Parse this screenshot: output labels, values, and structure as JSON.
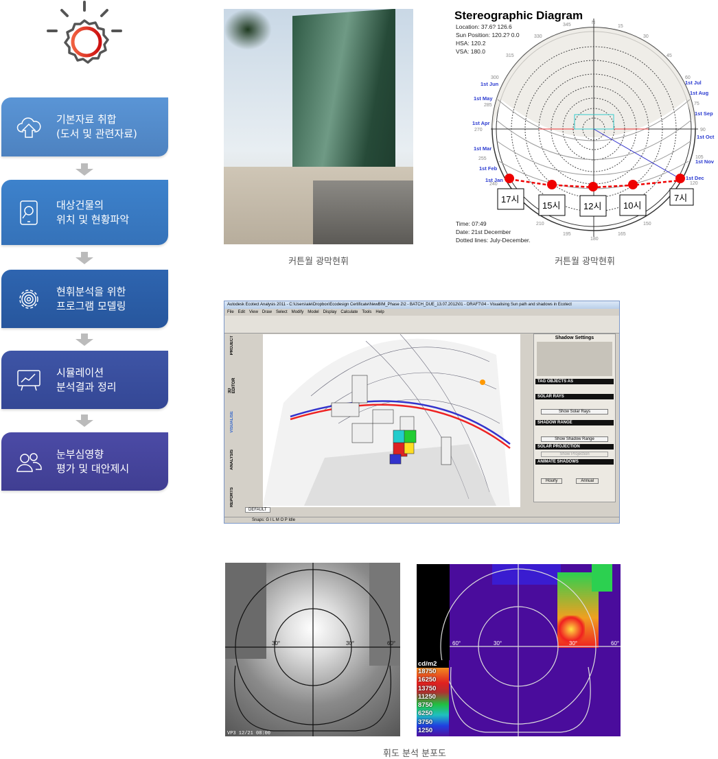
{
  "steps": [
    {
      "icon": "cloud-upload-icon",
      "label": "기본자료 취합\n(도서 및 관련자료)",
      "color": "#5690d2"
    },
    {
      "icon": "tablet-search-icon",
      "label": "대상건물의\n위치 및 현황파악",
      "color": "#3b7bc6"
    },
    {
      "icon": "gear-icon",
      "label": "현휘분석을 위한\n프로그램 모델링",
      "color": "#2c5ea9"
    },
    {
      "icon": "presentation-chart-icon",
      "label": "시뮬레이션\n분석결과 정리",
      "color": "#3a4d9f"
    },
    {
      "icon": "users-icon",
      "label": "눈부심영향\n평가 및 대안제시",
      "color": "#48479e"
    }
  ],
  "captions": {
    "photo": "커튼월 광막현휘",
    "diagram": "커튼월 광막현휘",
    "luminance": "휘도 분석 분포도"
  },
  "diagram": {
    "title": "Stereographic Diagram",
    "info": [
      "Location: 37.6? 126.6",
      "Sun Position: 120.2? 0.0",
      "HSA: 120.2",
      "VSA: 180.0"
    ],
    "footer": [
      "Time: 07:49",
      "Date: 21st December",
      "Dotted lines: July-December."
    ],
    "north": "N",
    "months_left": [
      "1st Jun",
      "1st May",
      "1st Apr",
      "1st Mar",
      "1st Feb",
      "1st Jan"
    ],
    "months_right": [
      "1st Jul",
      "1st Aug",
      "1st Sep",
      "1st Oct",
      "1st Nov",
      "1st Dec"
    ],
    "hour_boxes": [
      "17시",
      "15시",
      "12시",
      "10시",
      "7시"
    ],
    "angles": {
      "a345": "345",
      "a15": "15",
      "a330": "330",
      "a30": "30",
      "a315": "315",
      "a45": "45",
      "a300": "300",
      "a60": "60",
      "a285": "285",
      "a75": "75",
      "a270": "270",
      "a90": "90",
      "a255": "255",
      "a105": "105",
      "a240": "240",
      "a120": "120",
      "a210": "210",
      "a150": "150",
      "a195": "195",
      "a165": "165",
      "a180": "180"
    }
  },
  "ecotect": {
    "title": "Autodesk Ecotect Analysis 2011 - C:\\Users\\ale\\Dropbox\\Ecodesign Certificate\\NewBIM_Phase 2\\2 - BATCH_DUE_13.07.2012\\01 - DRAFT\\04 - Visualising Sun path and shadows in Ecotect",
    "menu": [
      "File",
      "Edit",
      "View",
      "Draw",
      "Select",
      "Modify",
      "Model",
      "Display",
      "Calculate",
      "Tools",
      "Help"
    ],
    "side_tabs": [
      "PROJECT",
      "3D EDITOR",
      "VISUALISE",
      "ANALYSIS",
      "REPORTS"
    ],
    "panel_title": "Shadow Settings",
    "sections": [
      "TAG OBJECTS AS",
      "SOLAR RAYS",
      "SHADOW RANGE",
      "SOLAR PROJECTION",
      "ANIMATE SHADOWS"
    ],
    "buttons": [
      "Show Solar Rays",
      "Show Shadow Range",
      "Show Projection",
      "Hourly",
      "Annual"
    ],
    "status": "Snaps:   G I L M O P  Idle",
    "tab": "DEFAULT"
  },
  "luminance": {
    "unit": "cd/m2",
    "legend": [
      "18750",
      "16250",
      "13750",
      "11250",
      "8750",
      "6250",
      "3750",
      "1250"
    ],
    "stamp": "VP3 12/21 08:00",
    "angles": [
      "30°",
      "30°",
      "60°",
      "60°",
      "30°",
      "30°",
      "60°"
    ]
  }
}
